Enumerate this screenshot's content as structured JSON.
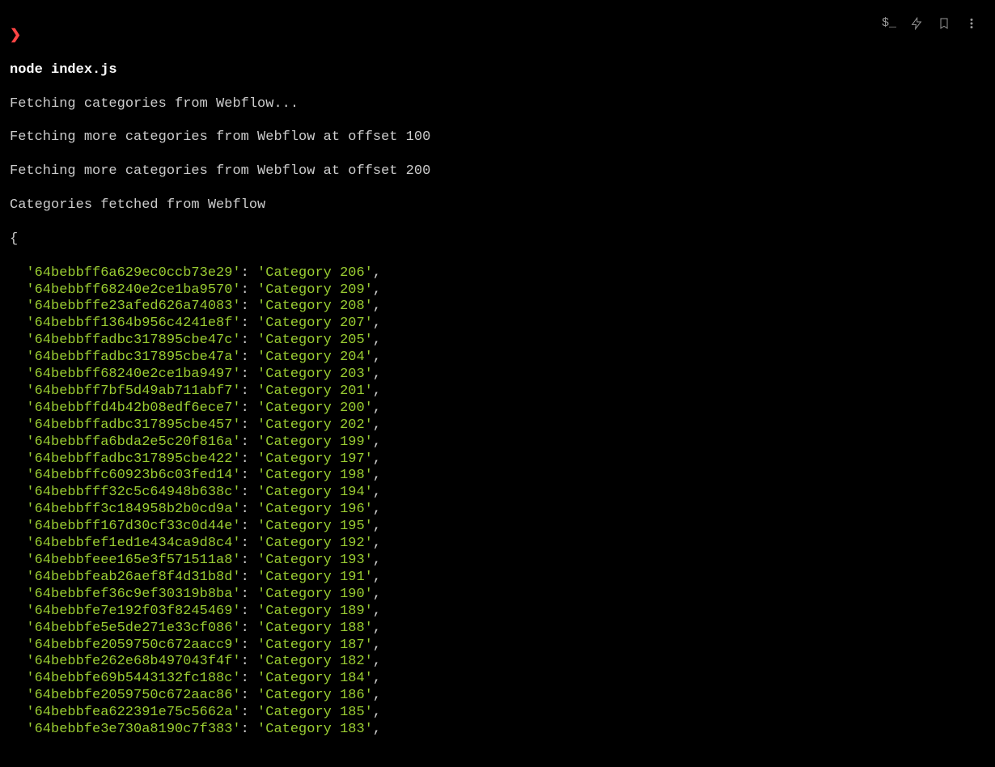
{
  "prompt": "❯",
  "command": "node index.js",
  "output_lines": [
    "Fetching categories from Webflow...",
    "Fetching more categories from Webflow at offset 100",
    "Fetching more categories from Webflow at offset 200",
    "Categories fetched from Webflow"
  ],
  "brace_open": "{",
  "entries": [
    {
      "key": "64bebbff6a629ec0ccb73e29",
      "value": "Category 206"
    },
    {
      "key": "64bebbff68240e2ce1ba9570",
      "value": "Category 209"
    },
    {
      "key": "64bebbffe23afed626a74083",
      "value": "Category 208"
    },
    {
      "key": "64bebbff1364b956c4241e8f",
      "value": "Category 207"
    },
    {
      "key": "64bebbffadbc317895cbe47c",
      "value": "Category 205"
    },
    {
      "key": "64bebbffadbc317895cbe47a",
      "value": "Category 204"
    },
    {
      "key": "64bebbff68240e2ce1ba9497",
      "value": "Category 203"
    },
    {
      "key": "64bebbff7bf5d49ab711abf7",
      "value": "Category 201"
    },
    {
      "key": "64bebbffd4b42b08edf6ece7",
      "value": "Category 200"
    },
    {
      "key": "64bebbffadbc317895cbe457",
      "value": "Category 202"
    },
    {
      "key": "64bebbffa6bda2e5c20f816a",
      "value": "Category 199"
    },
    {
      "key": "64bebbffadbc317895cbe422",
      "value": "Category 197"
    },
    {
      "key": "64bebbffc60923b6c03fed14",
      "value": "Category 198"
    },
    {
      "key": "64bebbfff32c5c64948b638c",
      "value": "Category 194"
    },
    {
      "key": "64bebbff3c184958b2b0cd9a",
      "value": "Category 196"
    },
    {
      "key": "64bebbff167d30cf33c0d44e",
      "value": "Category 195"
    },
    {
      "key": "64bebbfef1ed1e434ca9d8c4",
      "value": "Category 192"
    },
    {
      "key": "64bebbfeee165e3f571511a8",
      "value": "Category 193"
    },
    {
      "key": "64bebbfeab26aef8f4d31b8d",
      "value": "Category 191"
    },
    {
      "key": "64bebbfef36c9ef30319b8ba",
      "value": "Category 190"
    },
    {
      "key": "64bebbfe7e192f03f8245469",
      "value": "Category 189"
    },
    {
      "key": "64bebbfe5e5de271e33cf086",
      "value": "Category 188"
    },
    {
      "key": "64bebbfe2059750c672aacc9",
      "value": "Category 187"
    },
    {
      "key": "64bebbfe262e68b497043f4f",
      "value": "Category 182"
    },
    {
      "key": "64bebbfe69b5443132fc188c",
      "value": "Category 184"
    },
    {
      "key": "64bebbfe2059750c672aac86",
      "value": "Category 186"
    },
    {
      "key": "64bebbfea622391e75c5662a",
      "value": "Category 185"
    },
    {
      "key": "64bebbfe3e730a8190c7f383",
      "value": "Category 183"
    }
  ],
  "toolbar": {
    "command_prompt_label": "$_",
    "flash_label": "flash",
    "bookmark_label": "bookmark",
    "more_label": "more"
  }
}
